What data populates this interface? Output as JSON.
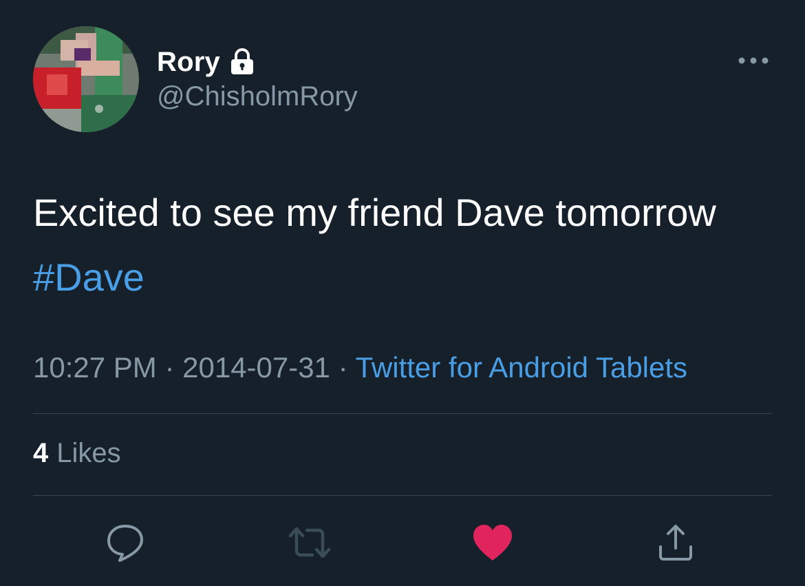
{
  "tweet": {
    "display_name": "Rory",
    "handle": "@ChisholmRory",
    "text_plain": "Excited to see my friend Dave tomorrow",
    "hashtag": "#Dave",
    "time": "10:27 PM",
    "separator": "·",
    "date": "2014-07-31",
    "source": "Twitter for Android Tablets",
    "likes_count": "4",
    "likes_label": "Likes"
  },
  "icons": {
    "verified_lock": "lock-icon",
    "more": "more-icon",
    "reply": "reply-icon",
    "retweet": "retweet-icon",
    "like": "heart-icon",
    "share": "share-icon"
  },
  "colors": {
    "background": "#15202b",
    "text_primary": "#ffffff",
    "text_secondary": "#8899a6",
    "link": "#4a9ee6",
    "like_active": "#e0245e",
    "divider": "#38444d"
  }
}
